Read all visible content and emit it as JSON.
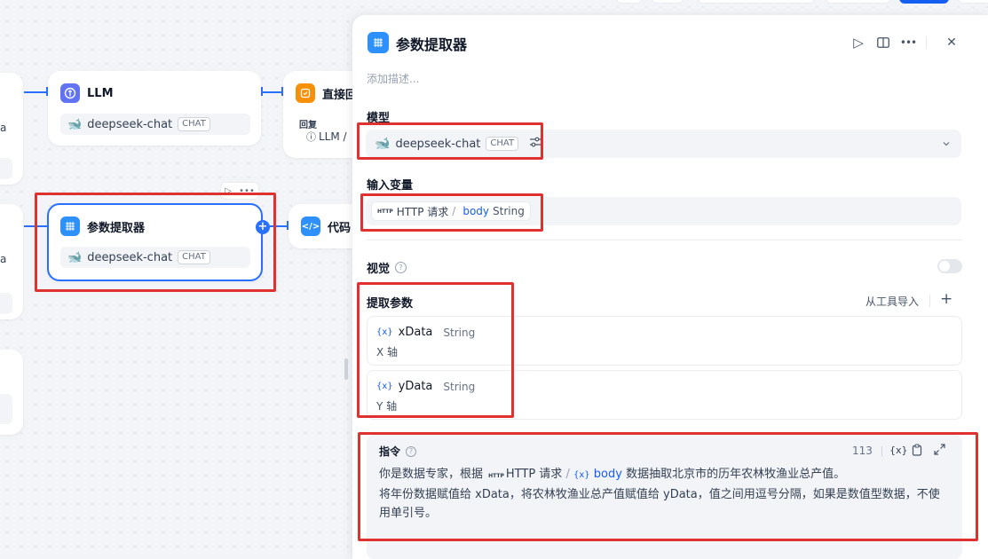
{
  "canvas": {
    "nodes": {
      "llm": {
        "title": "LLM",
        "model": "deepseek-chat",
        "mode_tag": "CHAT"
      },
      "direct_reply": {
        "title": "直接回",
        "label": "回复",
        "ref": "LLM /"
      },
      "param_extractor": {
        "title": "参数提取器",
        "model": "deepseek-chat",
        "mode_tag": "CHAT"
      },
      "code": {
        "title": "代码"
      },
      "left_stub": {
        "snippet": "a"
      }
    }
  },
  "panel": {
    "title": "参数提取器",
    "description_placeholder": "添加描述...",
    "model_section": {
      "label": "模型",
      "model": "deepseek-chat",
      "mode_tag": "CHAT"
    },
    "input_section": {
      "label": "输入变量",
      "variable": {
        "node": "HTTP 请求",
        "separator": "/",
        "name": "body",
        "type": "String"
      }
    },
    "vision": {
      "label": "视觉"
    },
    "params_section": {
      "label": "提取参数",
      "import_label": "从工具导入",
      "params": [
        {
          "name": "xData",
          "type": "String",
          "description": "X 轴"
        },
        {
          "name": "yData",
          "type": "String",
          "description": "Y 轴"
        }
      ]
    },
    "instruction": {
      "label": "指令",
      "count": "113",
      "line1_prefix": "你是数据专家，根据",
      "line1_node": "HTTP 请求",
      "line1_sep": "/",
      "line1_var": "body",
      "line1_suffix": "数据抽取北京市的历年农林牧渔业总产值。",
      "line2": "将年份数据赋值给 xData，将农林牧渔业总产值赋值给 yData，值之间用逗号分隔，如果是数值型数据，不使用单引号。"
    }
  },
  "colors": {
    "accent": "#2970ff",
    "highlight": "#e03131",
    "panel_icon": "#2e90fa",
    "llm_icon": "#6172f3",
    "reply_icon": "#f79009"
  }
}
